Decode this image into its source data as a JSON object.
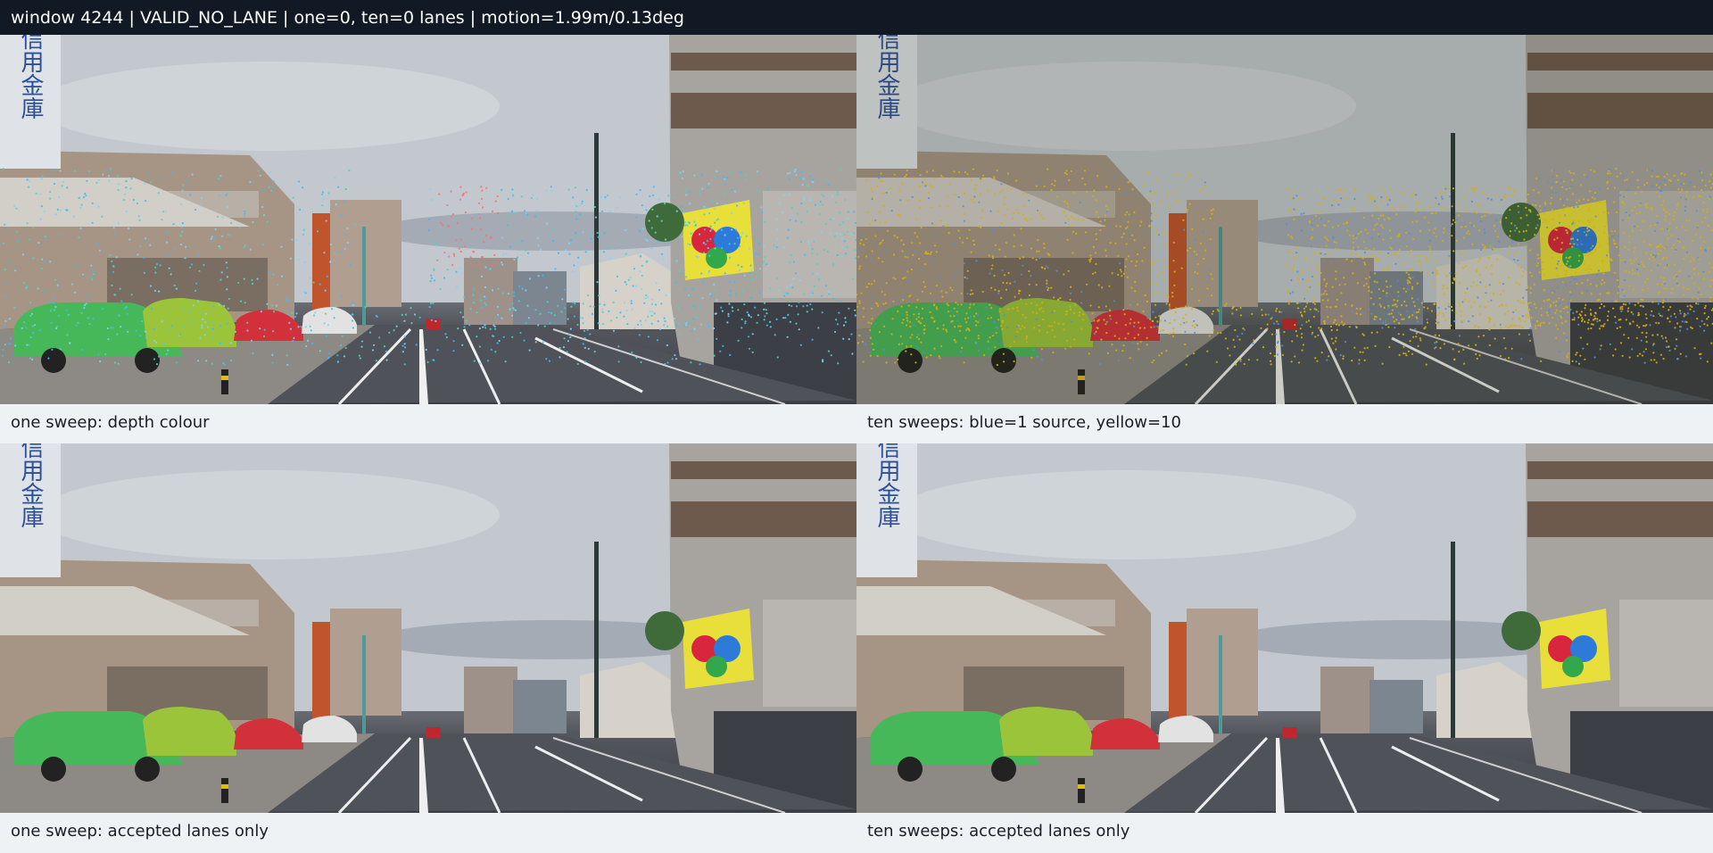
{
  "header": {
    "title": "window 4244 | VALID_NO_LANE | one=0, ten=0 lanes | motion=1.99m/0.13deg"
  },
  "panels": [
    {
      "caption": "one sweep: depth colour",
      "overlay": "depth"
    },
    {
      "caption": "ten sweeps: blue=1 source, yellow=10",
      "overlay": "sweeps"
    },
    {
      "caption": "one sweep: accepted lanes only",
      "overlay": "none"
    },
    {
      "caption": "ten sweeps: accepted lanes only",
      "overlay": "none"
    }
  ],
  "scene_text": {
    "bank_sign": "み信用金庫"
  },
  "colors": {
    "header_bg": "#111a24",
    "caption_bg": "#eef2f5",
    "depth_points": [
      "#4fd1c5",
      "#38bdf8",
      "#7dd3fc",
      "#f87171"
    ],
    "sweep_one": "#60a5fa",
    "sweep_ten": "#facc15"
  }
}
